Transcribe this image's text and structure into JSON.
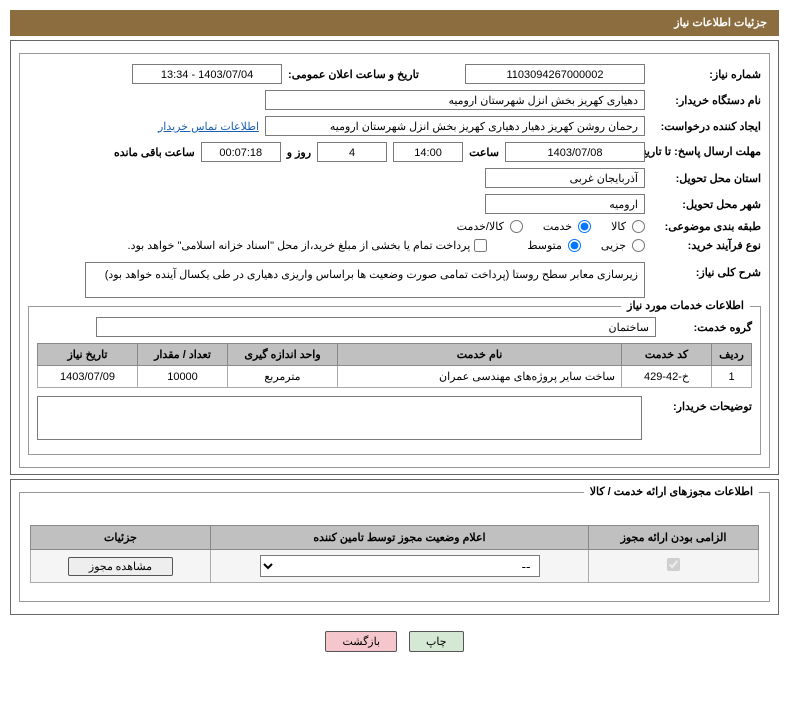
{
  "header": {
    "title": "جزئیات اطلاعات نیاز"
  },
  "need": {
    "number_label": "شماره نیاز:",
    "number": "1103094267000002",
    "announce_datetime_label": "تاریخ و ساعت اعلان عمومی:",
    "announce_datetime": "1403/07/04 - 13:34",
    "buyer_org_label": "نام دستگاه خریدار:",
    "buyer_org": "دهیاری کهریز بخش انزل شهرستان ارومیه",
    "requester_label": "ایجاد کننده درخواست:",
    "requester": "رحمان روشن کهریز دهیار دهیاری کهریز بخش انزل شهرستان ارومیه",
    "contact_link": "اطلاعات تماس خریدار",
    "deadline_label": "مهلت ارسال پاسخ: تا تاریخ:",
    "deadline_date": "1403/07/08",
    "time_label": "ساعت",
    "deadline_time": "14:00",
    "days": "4",
    "days_and": "روز و",
    "remaining_time": "00:07:18",
    "remaining_label": "ساعت باقی مانده",
    "province_label": "استان محل تحویل:",
    "province": "آذربایجان غربی",
    "city_label": "شهر محل تحویل:",
    "city": "ارومیه",
    "category_label": "طبقه بندی موضوعی:",
    "cat_goods": "کالا",
    "cat_service": "خدمت",
    "cat_goods_service": "کالا/خدمت",
    "buy_type_label": "نوع فرآیند خرید:",
    "buy_minor": "جزیی",
    "buy_medium": "متوسط",
    "treasury_note": "پرداخت تمام یا بخشی از مبلغ خرید،از محل \"اسناد خزانه اسلامی\" خواهد بود.",
    "desc_label": "شرح کلی نیاز:",
    "desc": "زیرسازی معابر سطح روستا (پرداخت تمامی صورت وضعیت ها براساس واریزی دهیاری در طی یکسال آینده خواهد بود)"
  },
  "services_section": {
    "title": "اطلاعات خدمات مورد نیاز",
    "group_label": "گروه خدمت:",
    "group": "ساختمان",
    "table": {
      "cols": {
        "row": "ردیف",
        "code": "کد خدمت",
        "name": "نام خدمت",
        "unit": "واحد اندازه گیری",
        "qty": "تعداد / مقدار",
        "date": "تاریخ نیاز"
      },
      "rows": [
        {
          "row": "1",
          "code": "خ-42-429",
          "name": "ساخت سایر پروژه‌های مهندسی عمران",
          "unit": "مترمربع",
          "qty": "10000",
          "date": "1403/07/09"
        }
      ]
    },
    "buyer_note_label": "توضیحات خریدار:"
  },
  "license_section": {
    "title": "اطلاعات مجوزهای ارائه خدمت / کالا",
    "cols": {
      "mandatory": "الزامی بودن ارائه مجوز",
      "status": "اعلام وضعیت مجوز توسط تامین کننده",
      "details": "جزئیات"
    },
    "dropdown_default": "--",
    "view_btn": "مشاهده مجوز"
  },
  "footer": {
    "print": "چاپ",
    "back": "بازگشت"
  }
}
